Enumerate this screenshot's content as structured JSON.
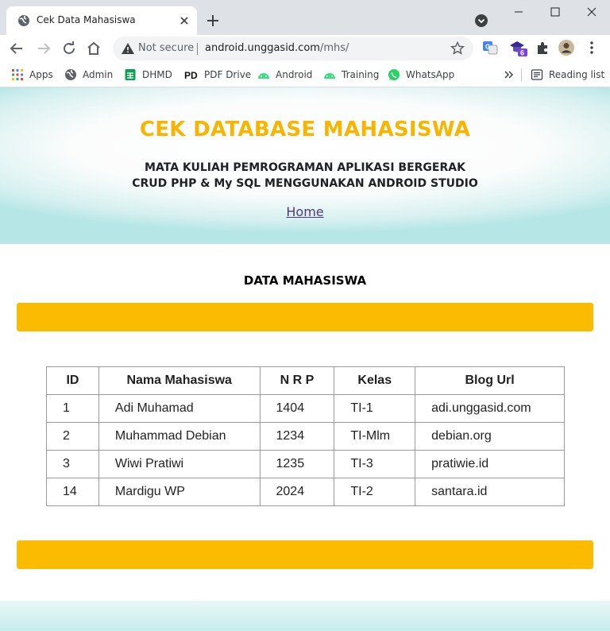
{
  "browser": {
    "tab": {
      "title": "Cek Data Mahasiswa"
    },
    "address": {
      "security_label": "Not secure",
      "host": "android.unggasid.com",
      "path": "/mhs/"
    },
    "bookmarks": [
      "Apps",
      "Admin",
      "DHMD",
      "PDF Drive",
      "Android",
      "Training",
      "WhatsApp"
    ],
    "reading_list_label": "Reading list",
    "extension_badge": "6"
  },
  "header": {
    "title": "CEK DATABASE MAHASISWA",
    "subtitle_line1": "MATA KULIAH PEMROGRAMAN APLIKASI BERGERAK",
    "subtitle_line2": "CRUD PHP & My SQL MENGGUNAKAN ANDROID STUDIO",
    "home_link": "Home"
  },
  "section_title": "DATA MAHASISWA",
  "table": {
    "headers": [
      "ID",
      "Nama Mahasiswa",
      "N R P",
      "Kelas",
      "Blog Url"
    ],
    "rows": [
      [
        "1",
        "Adi Muhamad",
        "1404",
        "TI-1",
        "adi.unggasid.com"
      ],
      [
        "2",
        "Muhammad Debian",
        "1234",
        "TI-Mlm",
        "debian.org"
      ],
      [
        "3",
        "Wiwi Pratiwi",
        "1235",
        "TI-3",
        "pratiwie.id"
      ],
      [
        "14",
        "Mardigu WP",
        "2024",
        "TI-2",
        "santara.id"
      ]
    ]
  },
  "colors": {
    "accent": "#f7b500",
    "bar": "#fbbb00",
    "link": "#4b3a86",
    "hero_edge": "#b6e6e6"
  }
}
